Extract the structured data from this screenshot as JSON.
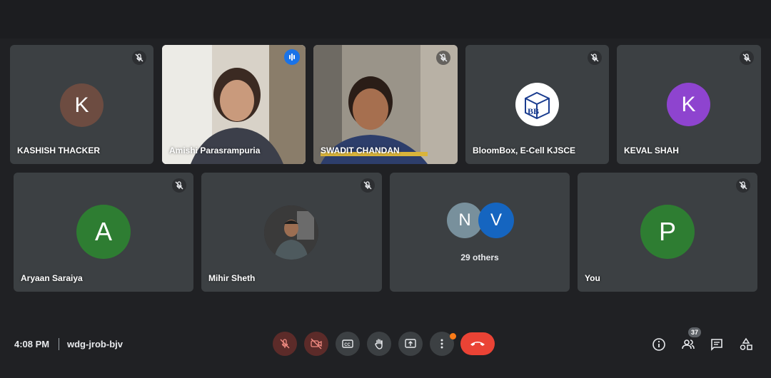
{
  "participants": [
    {
      "name": "KASHISH THACKER",
      "initial": "K",
      "color": "#6d4c41"
    },
    {
      "name": "Amishi Parasrampuria"
    },
    {
      "name": "SWADIT CHANDAN"
    },
    {
      "name": "BloomBox, E-Cell KJSCE",
      "logo_text": "BB"
    },
    {
      "name": "KEVAL SHAH",
      "initial": "K",
      "color": "#8e44cf"
    },
    {
      "name": "Aryaan Saraiya",
      "initial": "A",
      "color": "#2e7d32"
    },
    {
      "name": "Mihir Sheth"
    },
    {
      "name": "You",
      "initial": "P",
      "color": "#2e7d32"
    }
  ],
  "others": {
    "label": "29 others",
    "initials": [
      "N",
      "V"
    ],
    "colors": [
      "#78909c",
      "#1565c0"
    ]
  },
  "meeting": {
    "time": "4:08 PM",
    "code": "wdg-jrob-bjv"
  },
  "controls": {
    "icons": [
      "mic-off-icon",
      "camera-off-icon",
      "captions-icon",
      "raise-hand-icon",
      "present-icon",
      "more-options-icon",
      "end-call-icon"
    ],
    "people_count": "37",
    "right_icons": [
      "info-icon",
      "people-icon",
      "chat-icon",
      "activities-icon"
    ]
  },
  "colors": {
    "background": "#202124",
    "tile": "#3c4043",
    "accent": "#8ab4f8",
    "end_call": "#ea4335"
  }
}
